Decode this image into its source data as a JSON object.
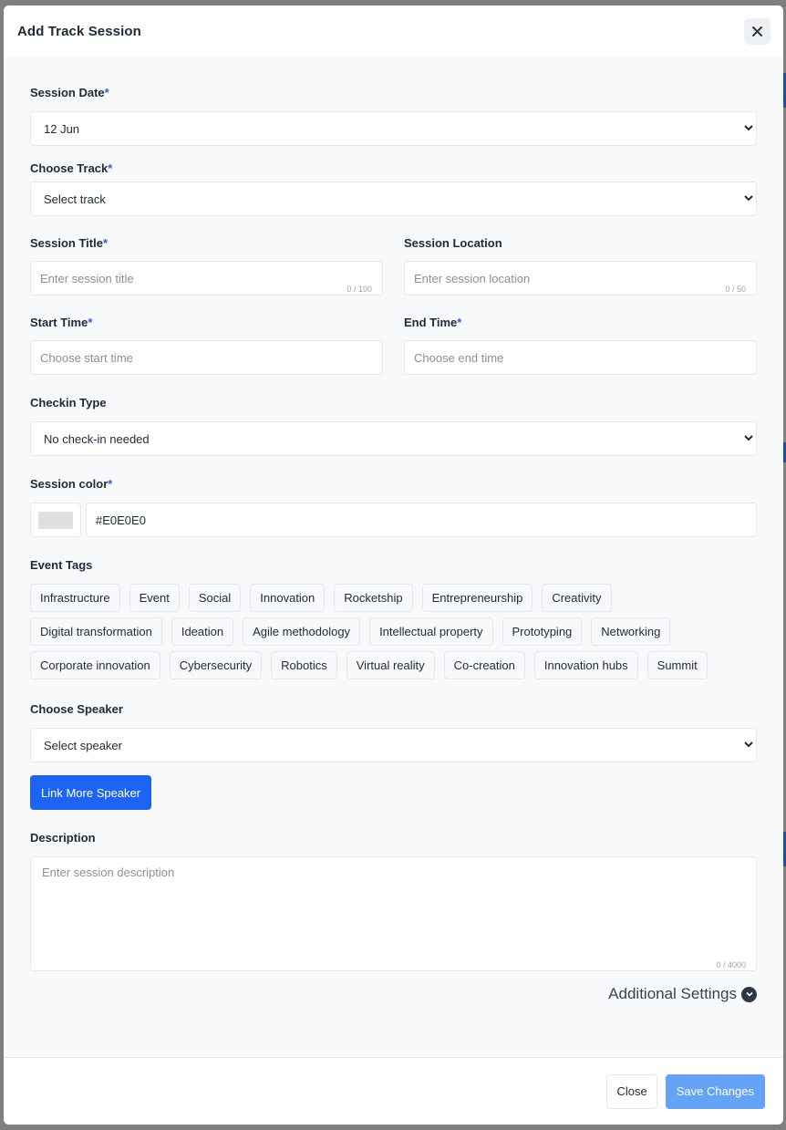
{
  "modal": {
    "title": "Add Track Session",
    "close_icon": "close-icon"
  },
  "form": {
    "session_date": {
      "label": "Session Date",
      "required": "*",
      "value": "12 Jun"
    },
    "choose_track": {
      "label": "Choose Track",
      "required": "*",
      "value": "Select track"
    },
    "session_title": {
      "label": "Session Title",
      "required": "*",
      "placeholder": "Enter session title",
      "counter": "0 / 100"
    },
    "session_location": {
      "label": "Session Location",
      "placeholder": "Enter session location",
      "counter": "0 / 50"
    },
    "start_time": {
      "label": "Start Time",
      "required": "*",
      "placeholder": "Choose start time"
    },
    "end_time": {
      "label": "End Time",
      "required": "*",
      "placeholder": "Choose end time"
    },
    "checkin_type": {
      "label": "Checkin Type",
      "value": "No check-in needed"
    },
    "session_color": {
      "label": "Session color",
      "required": "*",
      "value": "#E0E0E0",
      "swatch_color": "#e0e0e0"
    },
    "event_tags": {
      "label": "Event Tags",
      "items": [
        "Infrastructure",
        "Event",
        "Social",
        "Innovation",
        "Rocketship",
        "Entrepreneurship",
        "Creativity",
        "Digital transformation",
        "Ideation",
        "Agile methodology",
        "Intellectual property",
        "Prototyping",
        "Networking",
        "Corporate innovation",
        "Cybersecurity",
        "Robotics",
        "Virtual reality",
        "Co-creation",
        "Innovation hubs",
        "Summit"
      ]
    },
    "choose_speaker": {
      "label": "Choose Speaker",
      "value": "Select speaker"
    },
    "link_more_speaker": "Link More Speaker",
    "description": {
      "label": "Description",
      "placeholder": "Enter session description",
      "counter": "0 / 4000"
    },
    "additional_settings": "Additional Settings"
  },
  "footer": {
    "close_label": "Close",
    "save_label": "Save Changes"
  },
  "colors": {
    "accent": "#1d63f5",
    "save_disabled": "#65a3f8",
    "required_star": "#2563eb"
  }
}
